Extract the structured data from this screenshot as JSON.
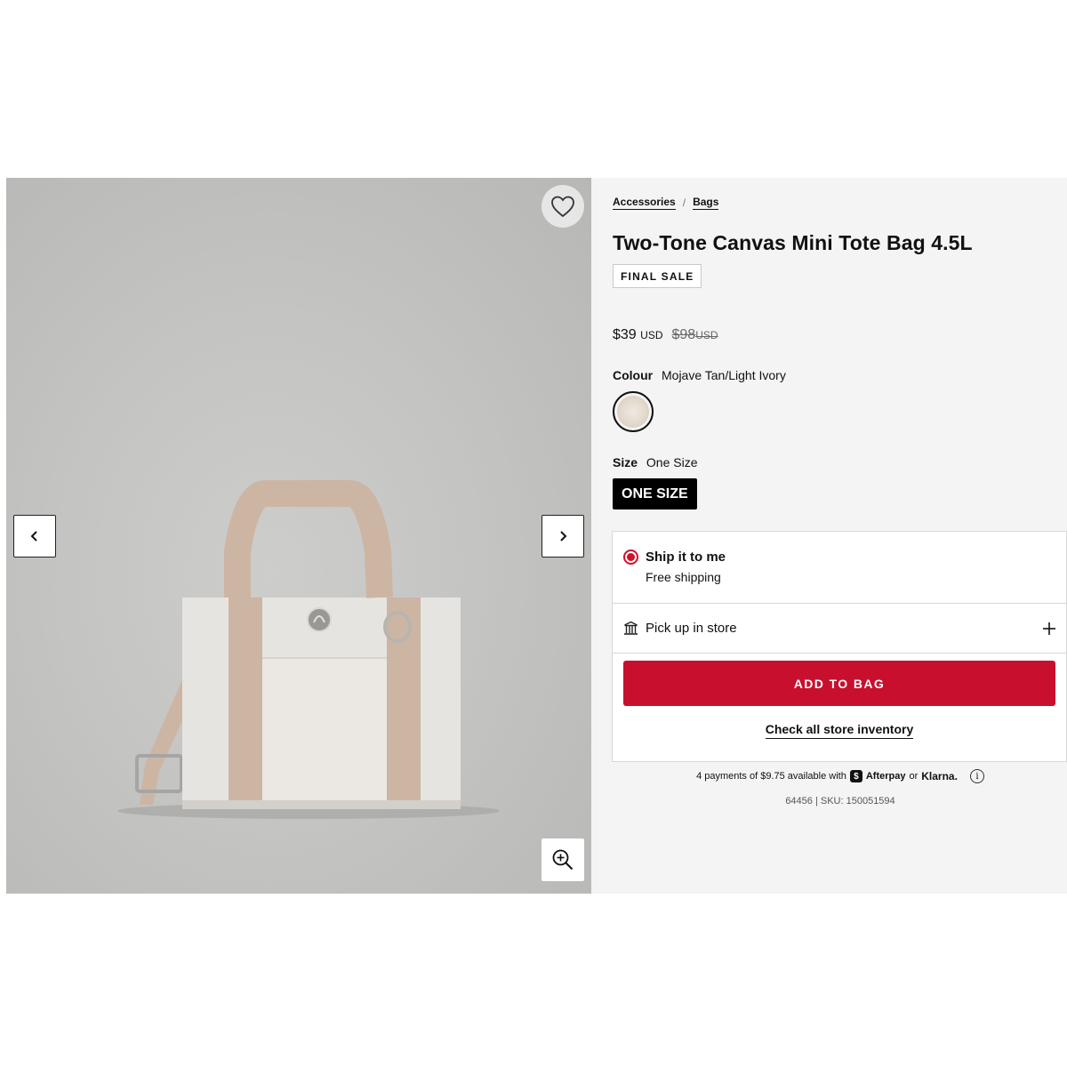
{
  "gallery": {
    "favorite_icon": "heart-outline-icon",
    "prev_icon": "chevron-left-icon",
    "next_icon": "chevron-right-icon",
    "zoom_icon": "zoom-in-icon",
    "image_subject": "tote-bag"
  },
  "breadcrumb": [
    {
      "label": "Accessories"
    },
    {
      "label": "Bags"
    }
  ],
  "breadcrumb_separator": "/",
  "product": {
    "title": "Two-Tone Canvas Mini Tote Bag 4.5L",
    "badge": "FINAL SALE",
    "price": "$39",
    "price_currency": "USD",
    "was_price": "$98",
    "was_currency": "USD",
    "colour_label": "Colour",
    "colour_value": "Mojave Tan/Light Ivory",
    "size_label": "Size",
    "size_value": "One Size",
    "size_option": "ONE SIZE"
  },
  "delivery": {
    "ship_title": "Ship it to me",
    "ship_subtitle": "Free shipping",
    "pickup_label": "Pick up in store",
    "add_to_bag": "ADD TO BAG",
    "check_inventory": "Check all store inventory"
  },
  "payments": {
    "prefix": "4 payments of $9.75 available with",
    "afterpay": "Afterpay",
    "or": "or",
    "klarna": "Klarna."
  },
  "sku_line": "64456 | SKU: 150051594",
  "colors": {
    "accent_red": "#c8102e",
    "background": "#f4f4f4"
  }
}
